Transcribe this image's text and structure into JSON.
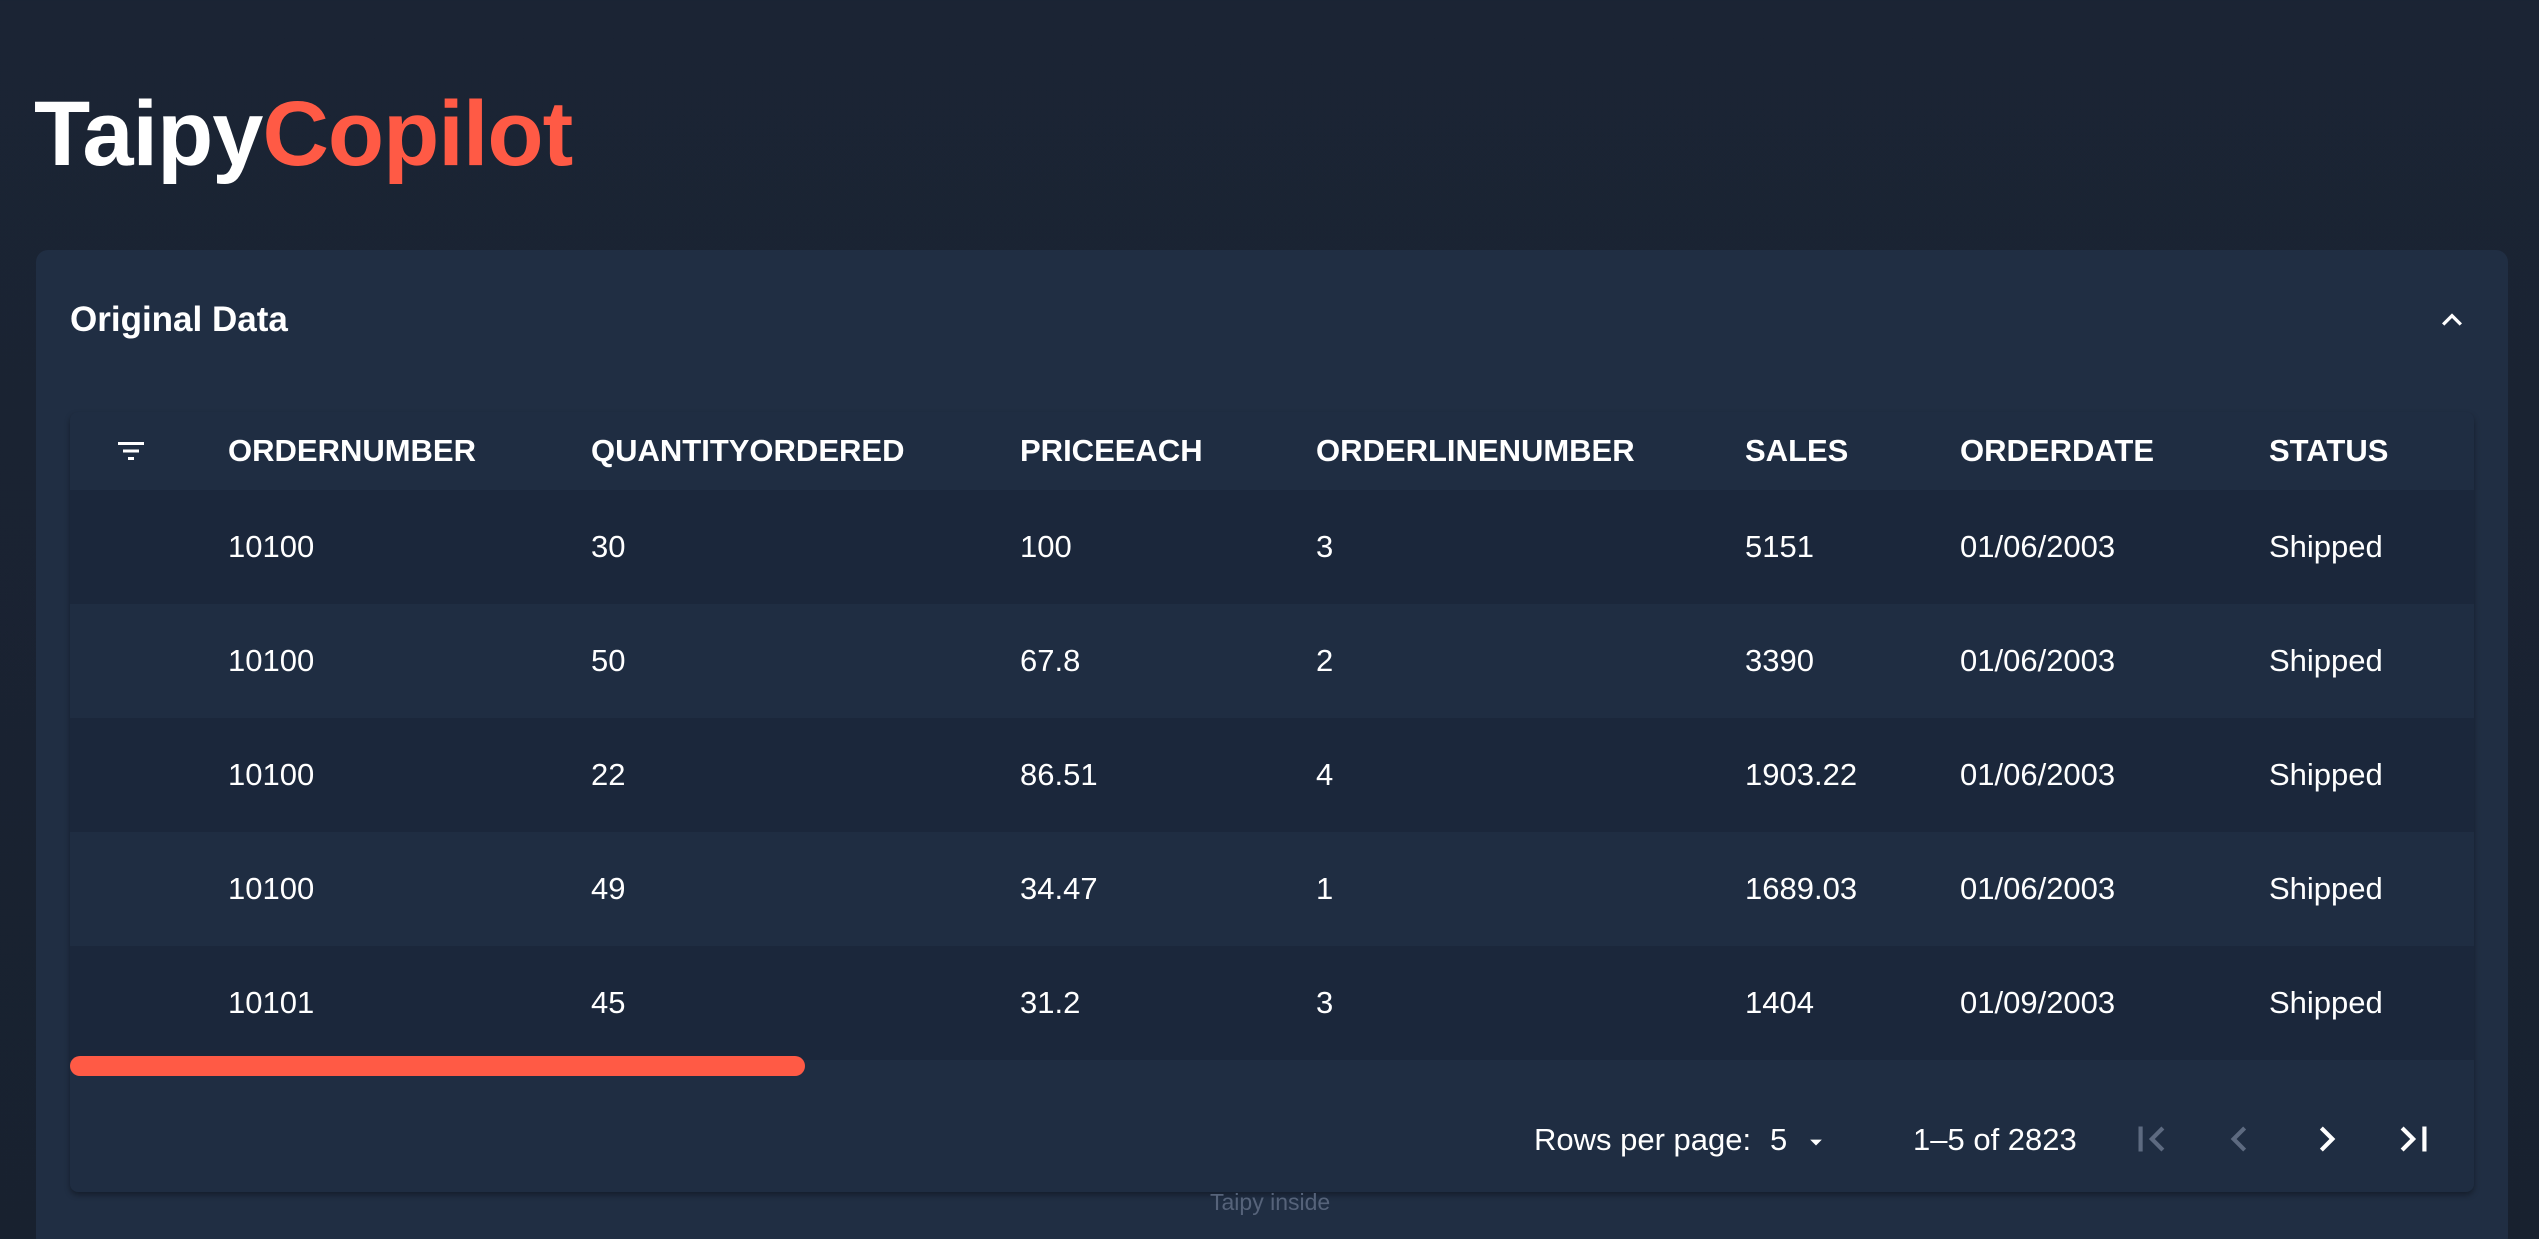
{
  "app": {
    "title_part1": "Taipy",
    "title_part2": "Copilot"
  },
  "panel": {
    "title": "Original Data"
  },
  "table": {
    "columns": [
      "ORDERNUMBER",
      "QUANTITYORDERED",
      "PRICEEACH",
      "ORDERLINENUMBER",
      "SALES",
      "ORDERDATE",
      "STATUS"
    ],
    "rows": [
      [
        "10100",
        "30",
        "100",
        "3",
        "5151",
        "01/06/2003",
        "Shipped"
      ],
      [
        "10100",
        "50",
        "67.8",
        "2",
        "3390",
        "01/06/2003",
        "Shipped"
      ],
      [
        "10100",
        "22",
        "86.51",
        "4",
        "1903.22",
        "01/06/2003",
        "Shipped"
      ],
      [
        "10100",
        "49",
        "34.47",
        "1",
        "1689.03",
        "01/06/2003",
        "Shipped"
      ],
      [
        "10101",
        "45",
        "31.2",
        "3",
        "1404",
        "01/09/2003",
        "Shipped"
      ]
    ]
  },
  "pagination": {
    "rows_per_page_label": "Rows per page:",
    "rows_per_page_value": "5",
    "range_text": "1–5 of 2823"
  },
  "footer": {
    "text": "Taipy inside"
  },
  "icons": {
    "filter": "filter-list-icon",
    "collapse": "chevron-up-icon",
    "dropdown": "caret-down-icon",
    "first": "first-page-icon",
    "prev": "chevron-left-icon",
    "next": "chevron-right-icon",
    "last": "last-page-icon"
  },
  "colors": {
    "accent": "#ff5a45",
    "background": "#18212f",
    "panel": "#202e43",
    "row_odd": "#1b273b",
    "row_even": "#1f2d42",
    "disabled_icon": "#5d6a80"
  }
}
